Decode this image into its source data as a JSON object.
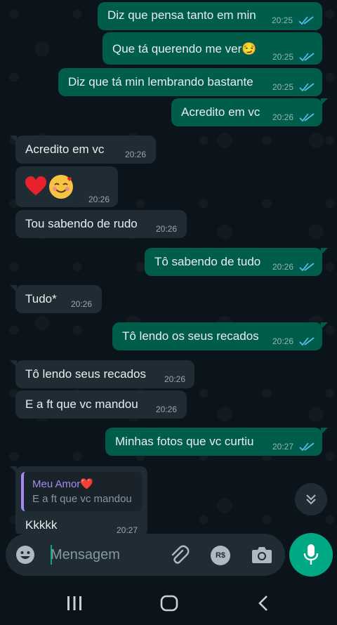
{
  "messages": [
    {
      "direction": "out",
      "text": "Diz que pensa tanto em min",
      "time": "20:25",
      "read": true
    },
    {
      "direction": "out",
      "text": "Que tá querendo me ver😏",
      "time": "20:25",
      "read": true
    },
    {
      "direction": "out",
      "text": "Diz que tá min lembrando bastante",
      "time": "20:25",
      "read": true
    },
    {
      "direction": "out",
      "text": "Acredito em vc",
      "time": "20:26",
      "read": true
    },
    {
      "direction": "in",
      "text": "Acredito  em vc",
      "time": "20:26"
    },
    {
      "direction": "in",
      "text": "❤️🥰",
      "time": "20:26"
    },
    {
      "direction": "in",
      "text": "Tou sabendo de rudo",
      "time": "20:26"
    },
    {
      "direction": "out",
      "text": "Tô sabendo de tudo",
      "time": "20:26",
      "read": true
    },
    {
      "direction": "in",
      "text": "Tudo*",
      "time": "20:26"
    },
    {
      "direction": "out",
      "text": "Tô lendo os seus recados",
      "time": "20:26",
      "read": true
    },
    {
      "direction": "in",
      "text": "Tô lendo seus recados",
      "time": "20:26"
    },
    {
      "direction": "in",
      "text": "E a ft que vc mandou",
      "time": "20:26"
    },
    {
      "direction": "out",
      "text": "Minhas fotos que vc curtiu",
      "time": "20:27",
      "read": true
    },
    {
      "direction": "in",
      "text": "Kkkkk",
      "time": "20:27",
      "reply": {
        "author": "Meu Amor❤️",
        "text": "E a ft que vc mandou"
      }
    }
  ],
  "input": {
    "placeholder": "Mensagem"
  },
  "icons": {
    "emoji": "emoji-icon",
    "attach": "paperclip-icon",
    "payment": "rs-payment-icon",
    "camera": "camera-icon",
    "mic": "mic-icon",
    "scroll": "chevron-double-down-icon",
    "nav_recents": "recents-icon",
    "nav_home": "home-icon",
    "nav_back": "back-icon"
  },
  "colors": {
    "outgoing": "#005c4b",
    "incoming": "#202c33",
    "accent": "#00a884",
    "read_ticks": "#53bdeb",
    "background": "#0b141a"
  }
}
